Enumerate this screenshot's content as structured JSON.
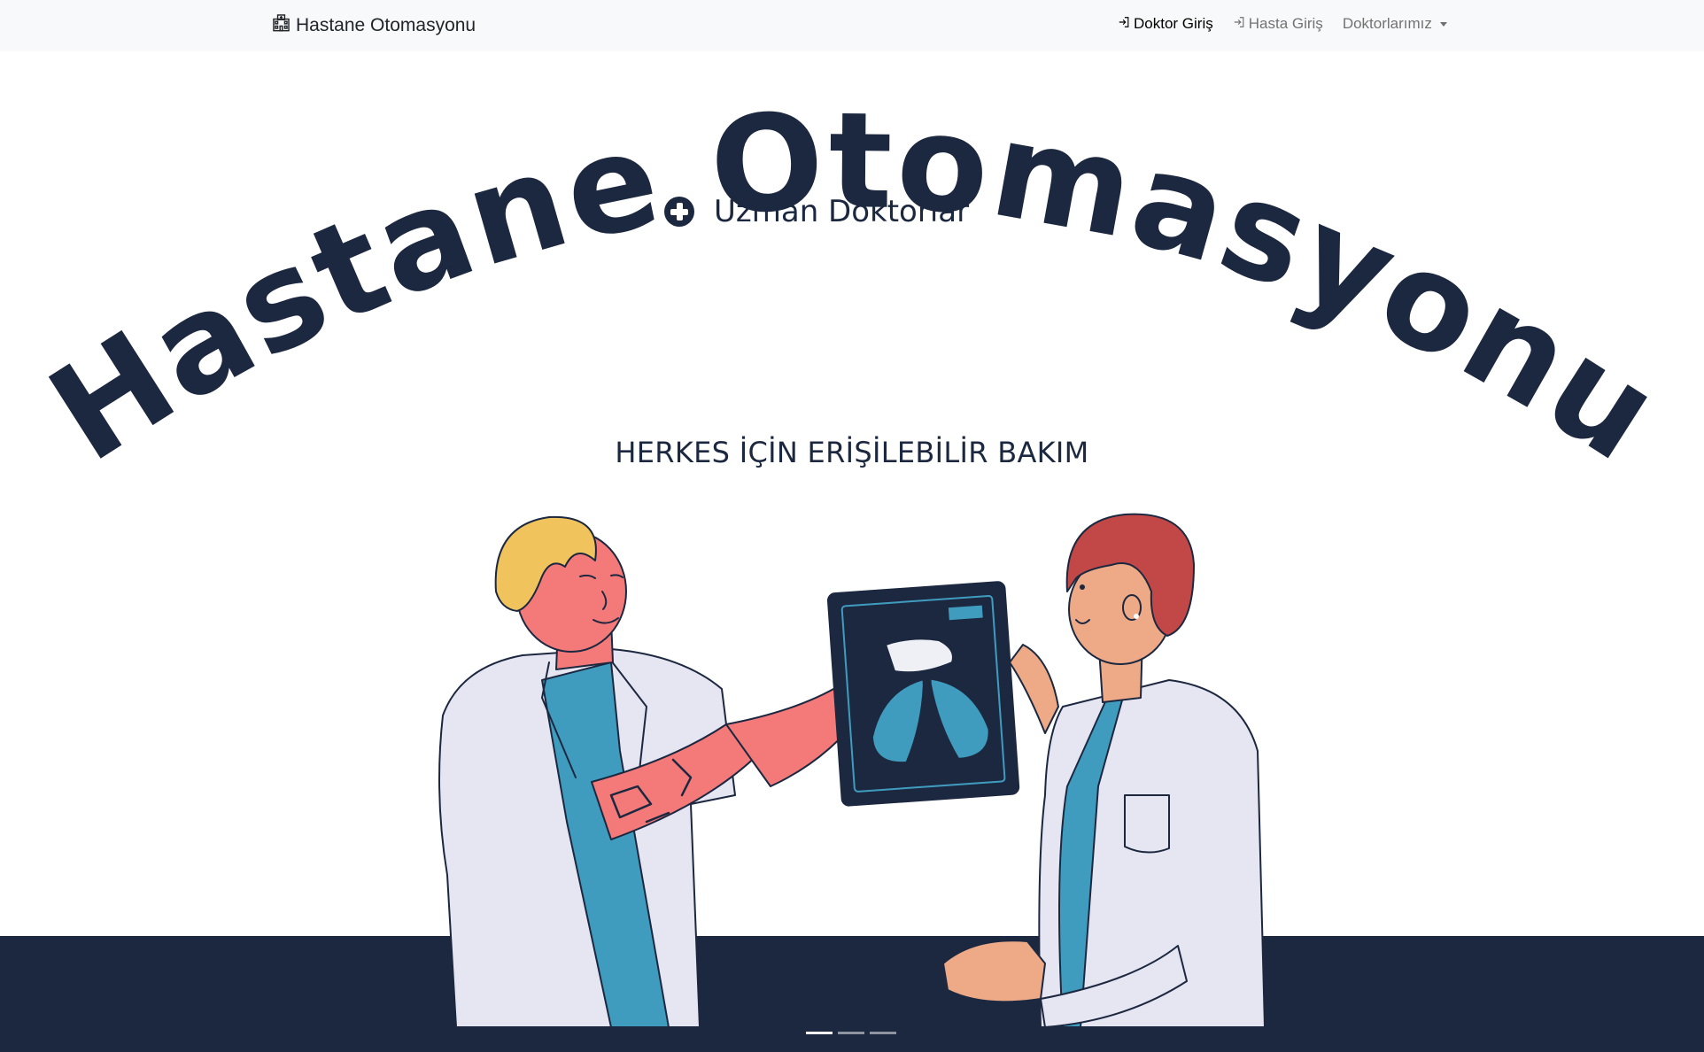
{
  "navbar": {
    "brand": "Hastane Otomasyonu",
    "brand_icon": "hospital-icon",
    "links": [
      {
        "label": "Doktor Giriş",
        "icon": "login-icon",
        "active": true
      },
      {
        "label": "Hasta Giriş",
        "icon": "login-icon",
        "active": false
      }
    ],
    "dropdown": {
      "label": "Doktorlarımız",
      "icon": "caret-down-icon"
    }
  },
  "hero": {
    "badge_label": "Uzman Doktorlar",
    "badge_icon": "plus-circle-icon",
    "title": "Hastane Otomasyonu",
    "subtitle": "HERKES İÇİN ERİŞİLEBİLİR BAKIM",
    "illustration": "doctors-xray-illustration"
  },
  "carousel": {
    "indicator_count": 3,
    "active_index": 0
  },
  "colors": {
    "navy": "#1c2840",
    "navbar_bg": "#f8f9fa",
    "coat": "#e6e5f2",
    "scrub": "#3f9cbf",
    "skin_pink": "#f47a7a",
    "skin_tan": "#eeaa86",
    "hair_blond": "#f0c35c",
    "hair_red": "#c24848"
  }
}
